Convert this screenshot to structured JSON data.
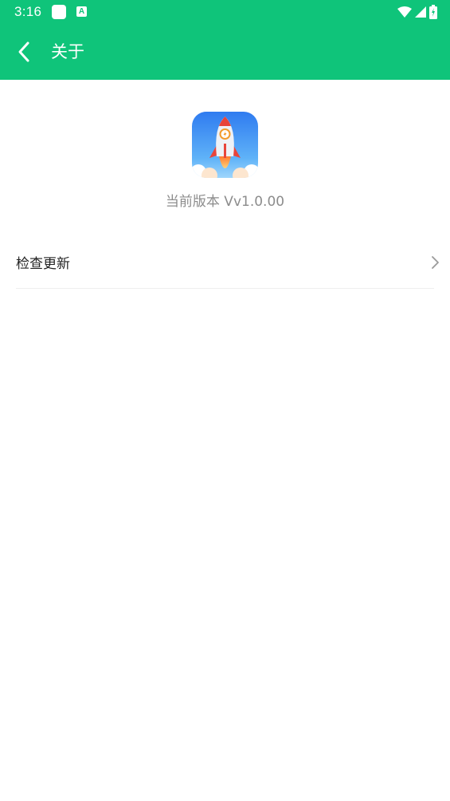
{
  "status_bar": {
    "time": "3:16",
    "notification_letter": "A",
    "icons": [
      "wifi-icon",
      "signal-icon",
      "battery-charging-icon"
    ]
  },
  "app_bar": {
    "title": "关于",
    "back_icon": "chevron-left-icon"
  },
  "about": {
    "app_icon": "rocket-app-icon",
    "version_text": "当前版本 Vv1.0.00"
  },
  "menu": {
    "items": [
      {
        "label": "检查更新",
        "icon": "chevron-right-icon"
      }
    ]
  },
  "colors": {
    "primary": "#0fc47a",
    "version_text": "#8c8c8c",
    "row_text": "#222222",
    "divider": "#eeeeee"
  }
}
